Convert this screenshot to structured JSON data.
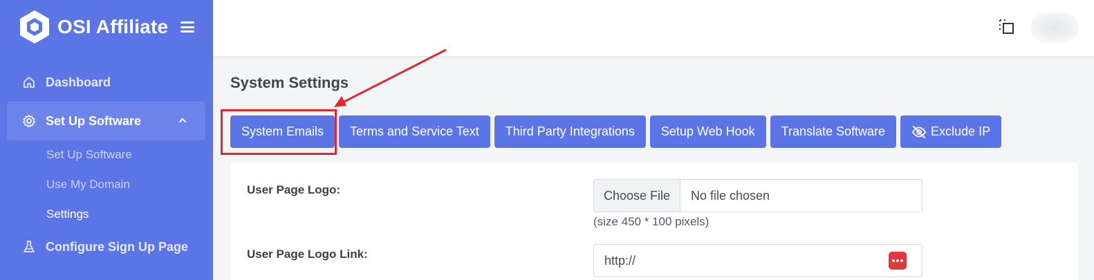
{
  "brand": {
    "name": "OSI Affiliate",
    "color": "#5c75e6"
  },
  "sidebar": {
    "items": [
      {
        "label": "Dashboard",
        "icon": "home-icon"
      },
      {
        "label": "Set Up Software",
        "icon": "gear-icon",
        "expanded": true
      },
      {
        "label": "Configure Sign Up Page",
        "icon": "flask-icon"
      }
    ],
    "subitems": [
      {
        "label": "Set Up Software"
      },
      {
        "label": "Use My Domain"
      },
      {
        "label": "Settings",
        "current": true
      }
    ]
  },
  "page": {
    "title": "System Settings"
  },
  "tabs": [
    {
      "label": "System Emails",
      "highlighted": true
    },
    {
      "label": "Terms and Service Text"
    },
    {
      "label": "Third Party Integrations"
    },
    {
      "label": "Setup Web Hook"
    },
    {
      "label": "Translate Software"
    },
    {
      "label": "Exclude IP",
      "icon": "eye-slash-icon"
    }
  ],
  "form": {
    "logo_label": "User Page Logo:",
    "file_button": "Choose File",
    "file_status": "No file chosen",
    "logo_hint": "(size 450 * 100 pixels)",
    "link_label": "User Page Logo Link:",
    "link_value": "http://"
  },
  "annotation": {
    "color": "#e3262e"
  }
}
